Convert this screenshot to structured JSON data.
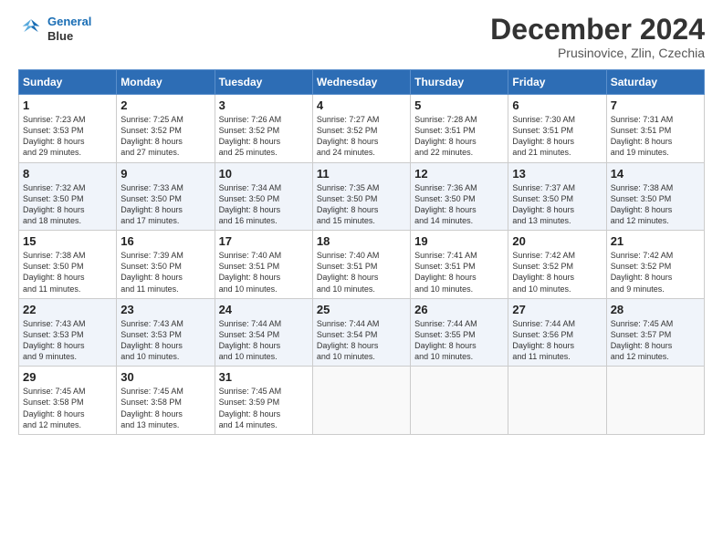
{
  "logo": {
    "line1": "General",
    "line2": "Blue"
  },
  "title": "December 2024",
  "subtitle": "Prusinovice, Zlin, Czechia",
  "days_header": [
    "Sunday",
    "Monday",
    "Tuesday",
    "Wednesday",
    "Thursday",
    "Friday",
    "Saturday"
  ],
  "weeks": [
    [
      {
        "day": "1",
        "lines": [
          "Sunrise: 7:23 AM",
          "Sunset: 3:53 PM",
          "Daylight: 8 hours",
          "and 29 minutes."
        ]
      },
      {
        "day": "2",
        "lines": [
          "Sunrise: 7:25 AM",
          "Sunset: 3:52 PM",
          "Daylight: 8 hours",
          "and 27 minutes."
        ]
      },
      {
        "day": "3",
        "lines": [
          "Sunrise: 7:26 AM",
          "Sunset: 3:52 PM",
          "Daylight: 8 hours",
          "and 25 minutes."
        ]
      },
      {
        "day": "4",
        "lines": [
          "Sunrise: 7:27 AM",
          "Sunset: 3:52 PM",
          "Daylight: 8 hours",
          "and 24 minutes."
        ]
      },
      {
        "day": "5",
        "lines": [
          "Sunrise: 7:28 AM",
          "Sunset: 3:51 PM",
          "Daylight: 8 hours",
          "and 22 minutes."
        ]
      },
      {
        "day": "6",
        "lines": [
          "Sunrise: 7:30 AM",
          "Sunset: 3:51 PM",
          "Daylight: 8 hours",
          "and 21 minutes."
        ]
      },
      {
        "day": "7",
        "lines": [
          "Sunrise: 7:31 AM",
          "Sunset: 3:51 PM",
          "Daylight: 8 hours",
          "and 19 minutes."
        ]
      }
    ],
    [
      {
        "day": "8",
        "lines": [
          "Sunrise: 7:32 AM",
          "Sunset: 3:50 PM",
          "Daylight: 8 hours",
          "and 18 minutes."
        ]
      },
      {
        "day": "9",
        "lines": [
          "Sunrise: 7:33 AM",
          "Sunset: 3:50 PM",
          "Daylight: 8 hours",
          "and 17 minutes."
        ]
      },
      {
        "day": "10",
        "lines": [
          "Sunrise: 7:34 AM",
          "Sunset: 3:50 PM",
          "Daylight: 8 hours",
          "and 16 minutes."
        ]
      },
      {
        "day": "11",
        "lines": [
          "Sunrise: 7:35 AM",
          "Sunset: 3:50 PM",
          "Daylight: 8 hours",
          "and 15 minutes."
        ]
      },
      {
        "day": "12",
        "lines": [
          "Sunrise: 7:36 AM",
          "Sunset: 3:50 PM",
          "Daylight: 8 hours",
          "and 14 minutes."
        ]
      },
      {
        "day": "13",
        "lines": [
          "Sunrise: 7:37 AM",
          "Sunset: 3:50 PM",
          "Daylight: 8 hours",
          "and 13 minutes."
        ]
      },
      {
        "day": "14",
        "lines": [
          "Sunrise: 7:38 AM",
          "Sunset: 3:50 PM",
          "Daylight: 8 hours",
          "and 12 minutes."
        ]
      }
    ],
    [
      {
        "day": "15",
        "lines": [
          "Sunrise: 7:38 AM",
          "Sunset: 3:50 PM",
          "Daylight: 8 hours",
          "and 11 minutes."
        ]
      },
      {
        "day": "16",
        "lines": [
          "Sunrise: 7:39 AM",
          "Sunset: 3:50 PM",
          "Daylight: 8 hours",
          "and 11 minutes."
        ]
      },
      {
        "day": "17",
        "lines": [
          "Sunrise: 7:40 AM",
          "Sunset: 3:51 PM",
          "Daylight: 8 hours",
          "and 10 minutes."
        ]
      },
      {
        "day": "18",
        "lines": [
          "Sunrise: 7:40 AM",
          "Sunset: 3:51 PM",
          "Daylight: 8 hours",
          "and 10 minutes."
        ]
      },
      {
        "day": "19",
        "lines": [
          "Sunrise: 7:41 AM",
          "Sunset: 3:51 PM",
          "Daylight: 8 hours",
          "and 10 minutes."
        ]
      },
      {
        "day": "20",
        "lines": [
          "Sunrise: 7:42 AM",
          "Sunset: 3:52 PM",
          "Daylight: 8 hours",
          "and 10 minutes."
        ]
      },
      {
        "day": "21",
        "lines": [
          "Sunrise: 7:42 AM",
          "Sunset: 3:52 PM",
          "Daylight: 8 hours",
          "and 9 minutes."
        ]
      }
    ],
    [
      {
        "day": "22",
        "lines": [
          "Sunrise: 7:43 AM",
          "Sunset: 3:53 PM",
          "Daylight: 8 hours",
          "and 9 minutes."
        ]
      },
      {
        "day": "23",
        "lines": [
          "Sunrise: 7:43 AM",
          "Sunset: 3:53 PM",
          "Daylight: 8 hours",
          "and 10 minutes."
        ]
      },
      {
        "day": "24",
        "lines": [
          "Sunrise: 7:44 AM",
          "Sunset: 3:54 PM",
          "Daylight: 8 hours",
          "and 10 minutes."
        ]
      },
      {
        "day": "25",
        "lines": [
          "Sunrise: 7:44 AM",
          "Sunset: 3:54 PM",
          "Daylight: 8 hours",
          "and 10 minutes."
        ]
      },
      {
        "day": "26",
        "lines": [
          "Sunrise: 7:44 AM",
          "Sunset: 3:55 PM",
          "Daylight: 8 hours",
          "and 10 minutes."
        ]
      },
      {
        "day": "27",
        "lines": [
          "Sunrise: 7:44 AM",
          "Sunset: 3:56 PM",
          "Daylight: 8 hours",
          "and 11 minutes."
        ]
      },
      {
        "day": "28",
        "lines": [
          "Sunrise: 7:45 AM",
          "Sunset: 3:57 PM",
          "Daylight: 8 hours",
          "and 12 minutes."
        ]
      }
    ],
    [
      {
        "day": "29",
        "lines": [
          "Sunrise: 7:45 AM",
          "Sunset: 3:58 PM",
          "Daylight: 8 hours",
          "and 12 minutes."
        ]
      },
      {
        "day": "30",
        "lines": [
          "Sunrise: 7:45 AM",
          "Sunset: 3:58 PM",
          "Daylight: 8 hours",
          "and 13 minutes."
        ]
      },
      {
        "day": "31",
        "lines": [
          "Sunrise: 7:45 AM",
          "Sunset: 3:59 PM",
          "Daylight: 8 hours",
          "and 14 minutes."
        ]
      },
      null,
      null,
      null,
      null
    ]
  ]
}
